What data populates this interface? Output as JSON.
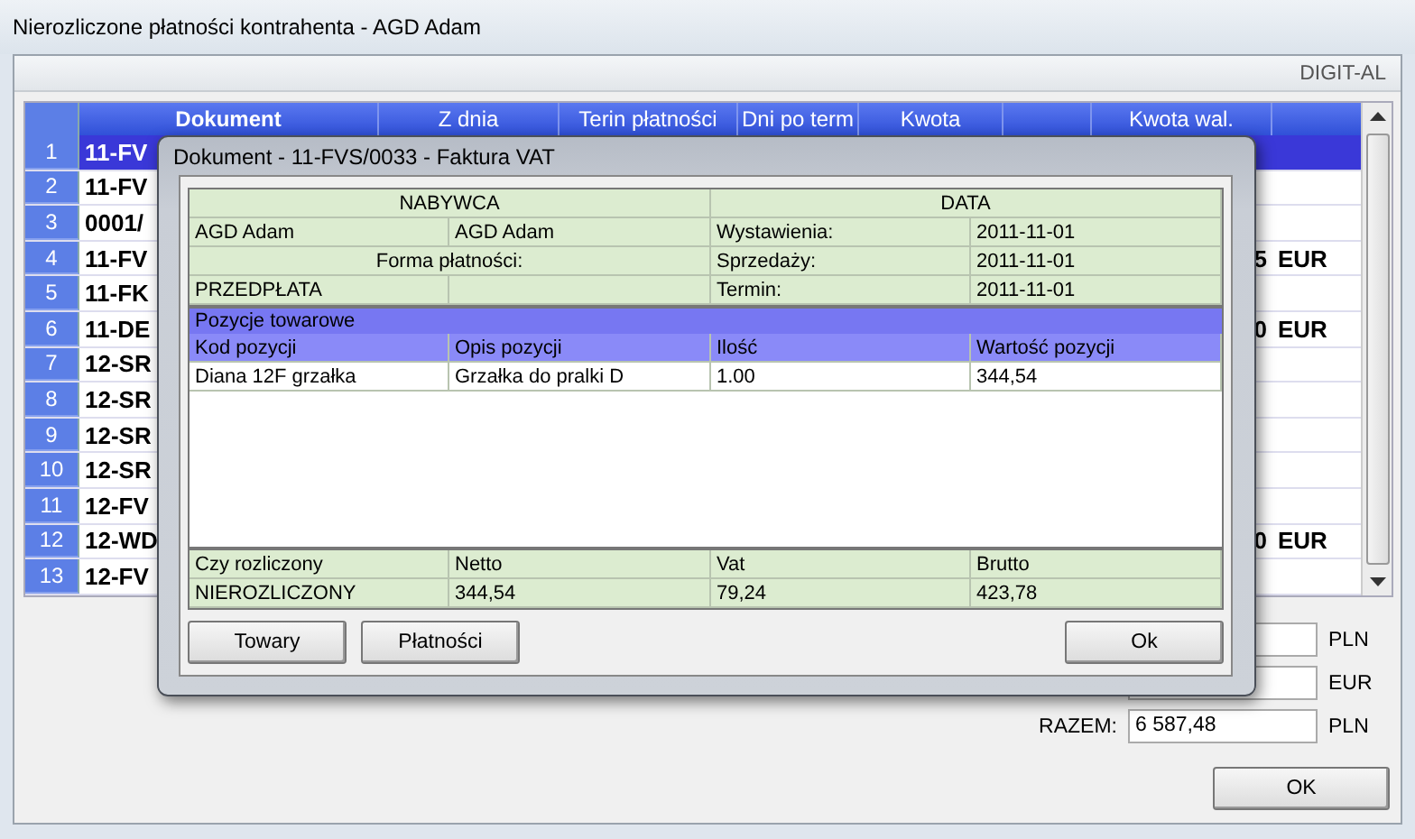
{
  "window": {
    "title": "Nierozliczone płatności kontrahenta - AGD Adam"
  },
  "brand": "DIGIT-AL",
  "grid": {
    "columns": [
      "Dokument",
      "Z dnia",
      "Terin płatności",
      "Dni po term",
      "Kwota",
      "Kwota wal."
    ],
    "rows": [
      {
        "number": "1",
        "document": "11-FV",
        "selected": true
      },
      {
        "number": "2",
        "document": "11-FV",
        "selected": false
      },
      {
        "number": "3",
        "document": "0001/",
        "selected": false
      },
      {
        "number": "4",
        "document": "11-FV",
        "amount": "5",
        "currency": "EUR",
        "selected": false
      },
      {
        "number": "5",
        "document": "11-FK",
        "selected": false
      },
      {
        "number": "6",
        "document": "11-DE",
        "amount": "0",
        "currency": "EUR",
        "selected": false
      },
      {
        "number": "7",
        "document": "12-SR",
        "selected": false
      },
      {
        "number": "8",
        "document": "12-SR",
        "selected": false
      },
      {
        "number": "9",
        "document": "12-SR",
        "selected": false
      },
      {
        "number": "10",
        "document": "12-SR",
        "selected": false
      },
      {
        "number": "11",
        "document": "12-FV",
        "selected": false
      },
      {
        "number": "12",
        "document": "12-WD",
        "amount": "0",
        "currency": "EUR",
        "selected": false
      },
      {
        "number": "13",
        "document": "12-FV",
        "selected": false
      }
    ]
  },
  "totals": [
    {
      "currency": "PLN"
    },
    {
      "currency": "EUR"
    },
    {
      "label": "RAZEM:",
      "value": "6 587,48",
      "currency": "PLN"
    }
  ],
  "ok_button": "OK",
  "dialog": {
    "title": "Dokument - 11-FVS/0033 - Faktura VAT",
    "buyer": {
      "heading": "NABYWCA",
      "name_1": "AGD Adam",
      "name_2": "AGD Adam",
      "payment_label": "Forma płatności:",
      "payment": "PRZEDPŁATA"
    },
    "dates": {
      "heading": "DATA",
      "rows": [
        {
          "label": "Wystawienia:",
          "value": "2011-11-01"
        },
        {
          "label": "Sprzedaży:",
          "value": "2011-11-01"
        },
        {
          "label": "Termin:",
          "value": "2011-11-01"
        }
      ]
    },
    "items": {
      "title": "Pozycje towarowe",
      "columns": [
        "Kod pozycji",
        "Opis pozycji",
        "Ilość",
        "Wartość pozycji"
      ],
      "rows": [
        [
          "Diana 12F grzałka",
          "Grzałka do pralki D",
          "1.00",
          "344,54"
        ]
      ]
    },
    "summary": {
      "columns": [
        "Czy rozliczony",
        "Netto",
        "Vat",
        "Brutto"
      ],
      "values": [
        "NIEROZLICZONY",
        "344,54",
        "79,24",
        "423,78"
      ]
    },
    "left_buttons": [
      "Towary",
      "Płatności"
    ],
    "right_buttons": [
      "Ok"
    ]
  }
}
